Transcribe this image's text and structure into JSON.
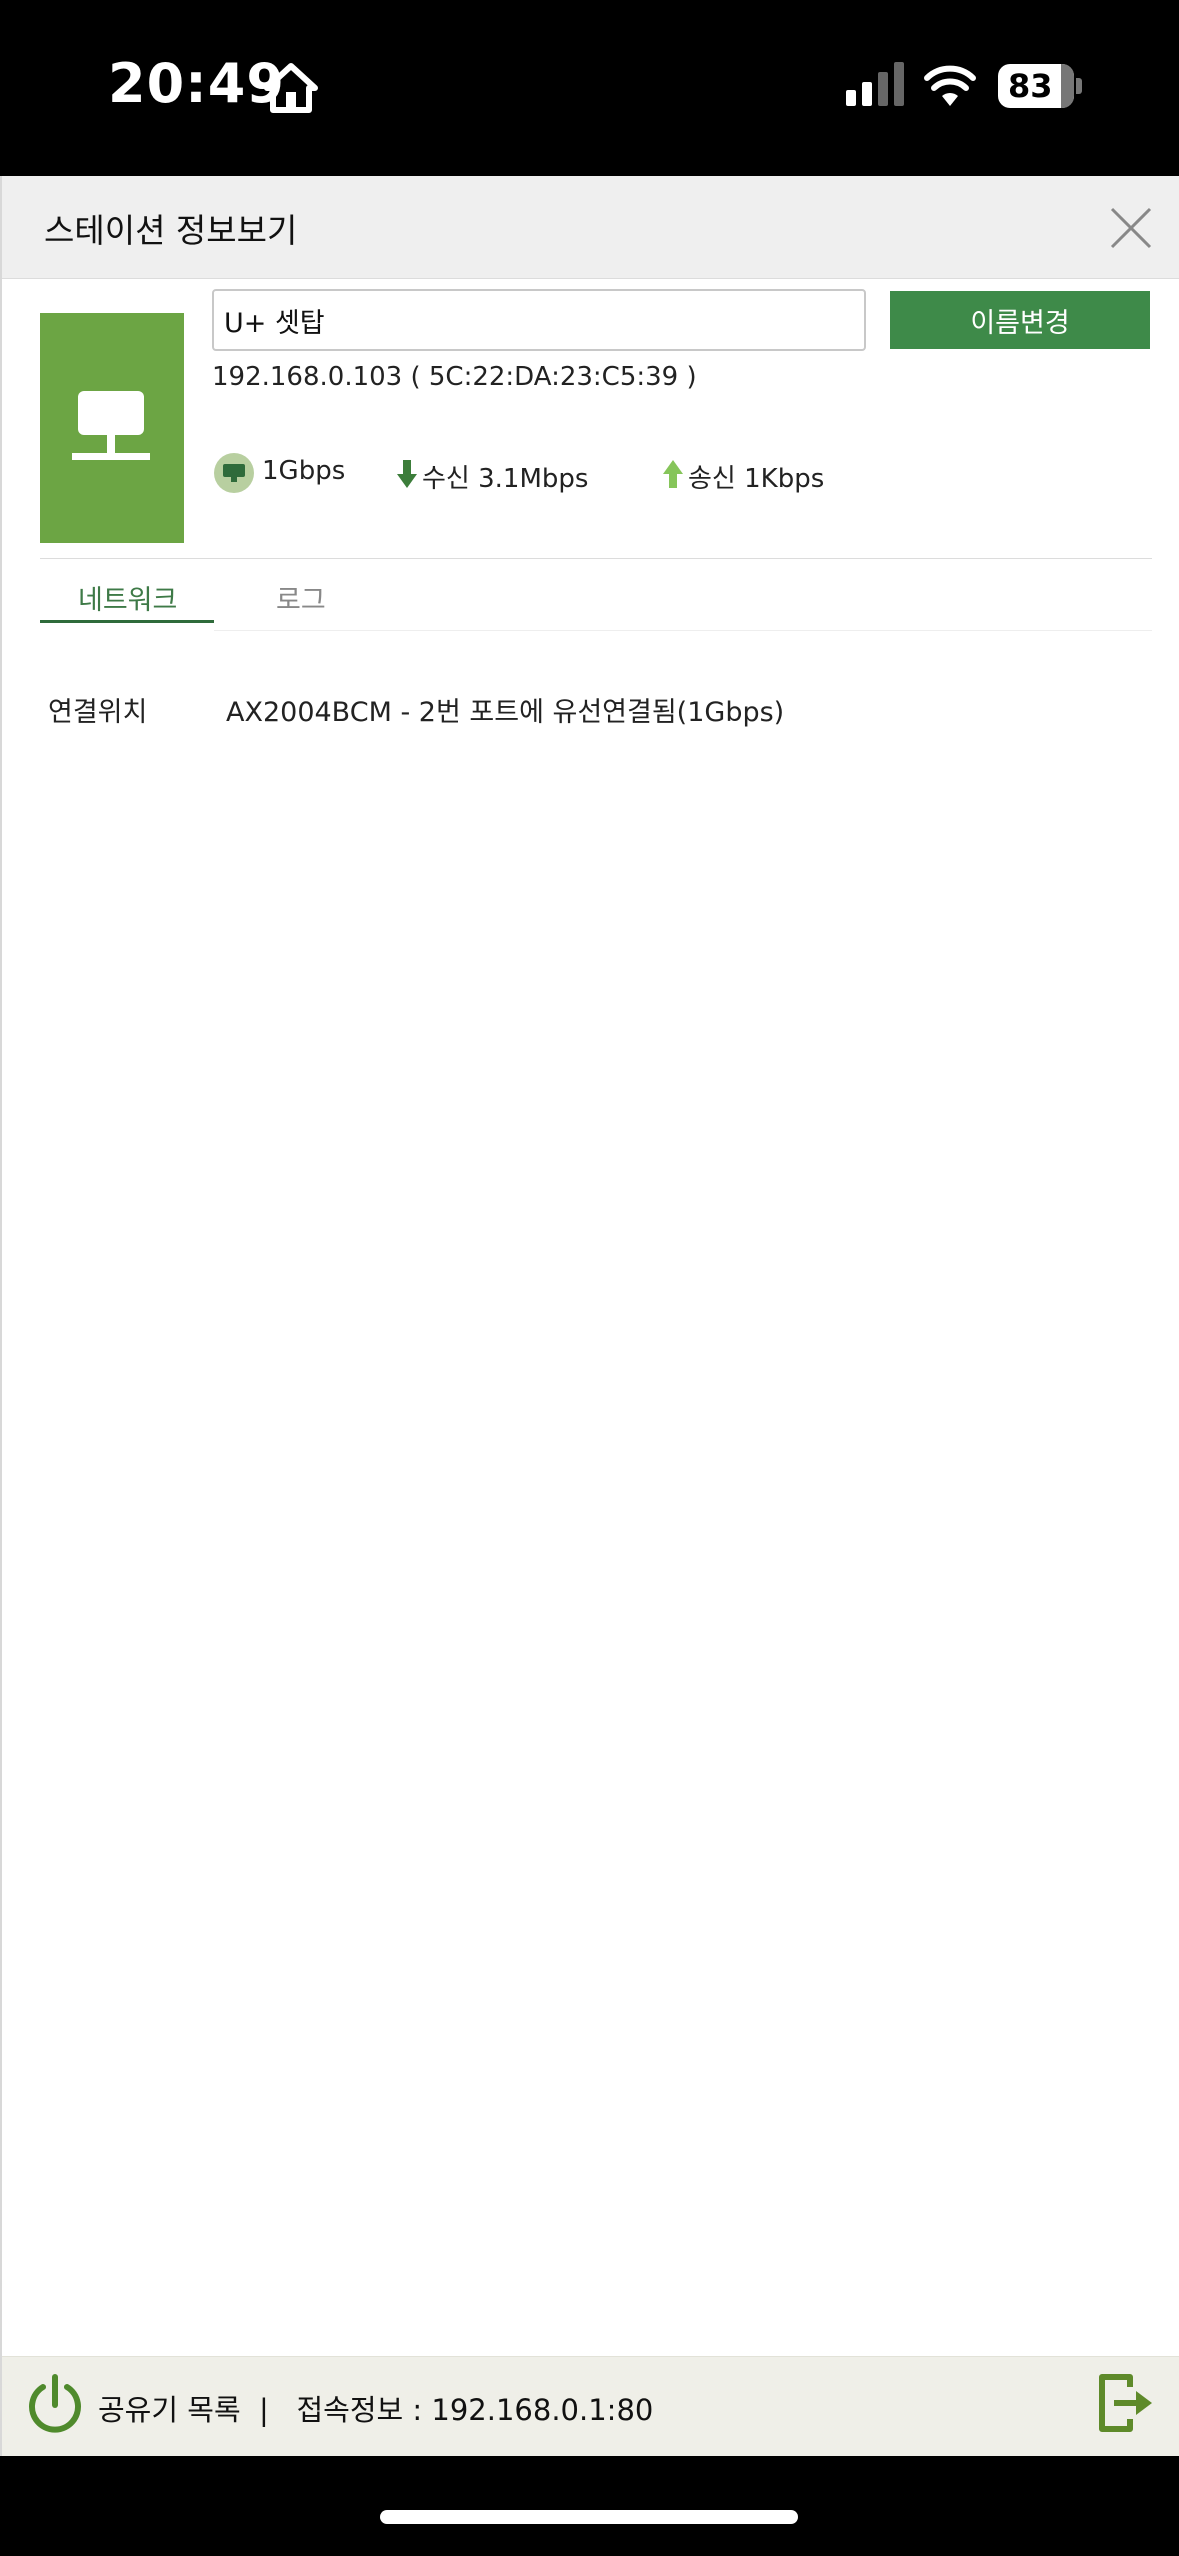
{
  "status_bar": {
    "time": "20:49",
    "battery": "83"
  },
  "header": {
    "title": "스테이션 정보보기"
  },
  "device": {
    "name_value": "U+ 셋탑",
    "rename_button": "이름변경",
    "ip_mac": "192.168.0.103 ( 5C:22:DA:23:C5:39 )",
    "link_speed": "1Gbps",
    "download": "수신 3.1Mbps",
    "upload": "송신 1Kbps"
  },
  "tabs": [
    {
      "label": "네트워크",
      "active": true
    },
    {
      "label": "로그",
      "active": false
    }
  ],
  "network": {
    "connection_label": "연결위치",
    "connection_value": "AX2004BCM - 2번 포트에 유선연결됨(1Gbps)"
  },
  "footer": {
    "text": "공유기 목록  |   접속정보 : 192.168.0.1:80"
  },
  "colors": {
    "accent_green": "#3e8a49",
    "device_green": "#6ca544",
    "down_arrow": "#3c7d3a",
    "up_arrow": "#86c55a"
  },
  "icons": {
    "home": "home-icon",
    "close": "close-icon",
    "device": "desktop-computer-icon",
    "speed": "ethernet-icon",
    "power": "power-icon",
    "exit": "exit-icon"
  }
}
